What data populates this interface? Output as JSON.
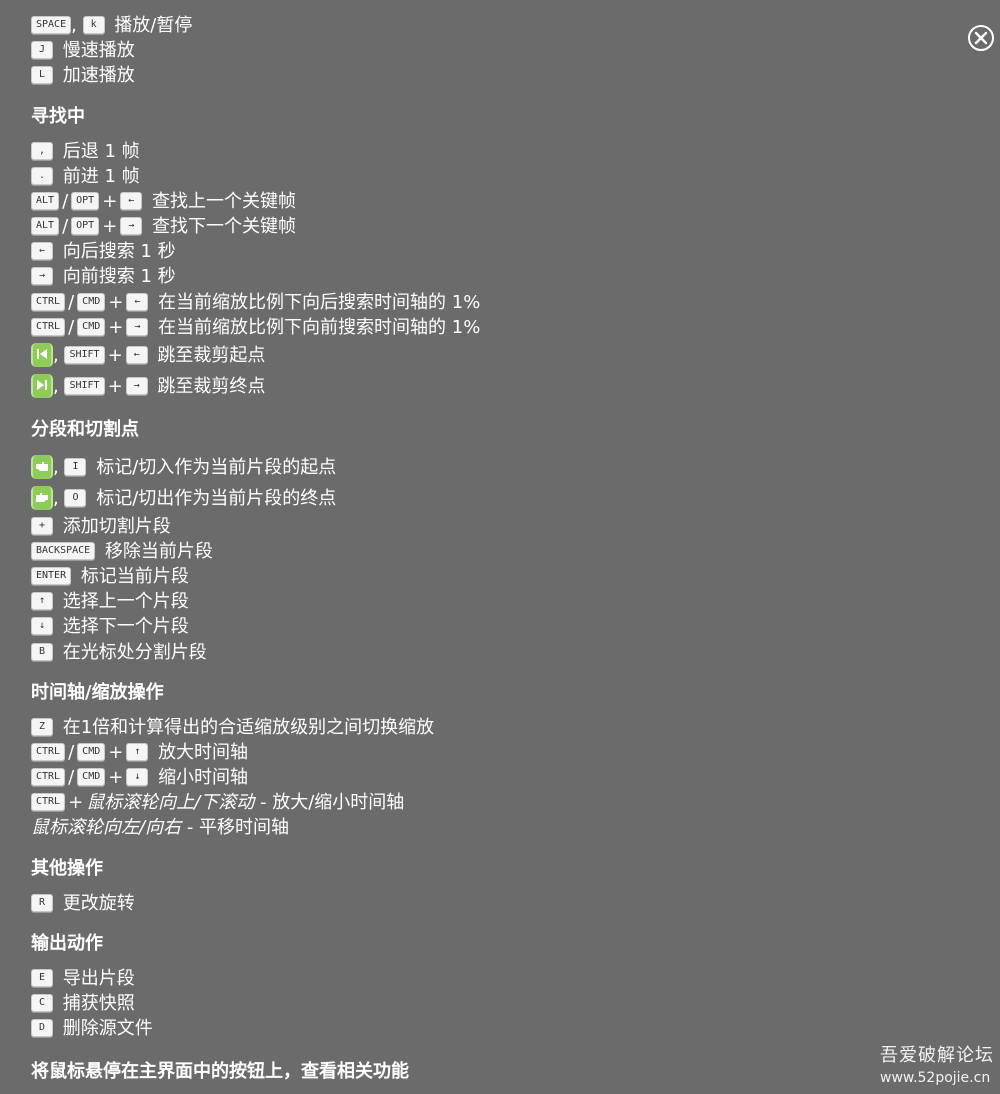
{
  "sections": {
    "playback": {
      "rows": [
        {
          "keys": [
            "SPACE",
            "k"
          ],
          "desc": "播放/暂停"
        },
        {
          "keys": [
            "J"
          ],
          "desc": "慢速播放"
        },
        {
          "keys": [
            "L"
          ],
          "desc": "加速播放"
        }
      ]
    },
    "seeking": {
      "title": "寻找中",
      "rows": [
        {
          "keys": [
            ","
          ],
          "desc": "后退 1 帧"
        },
        {
          "keys": [
            "."
          ],
          "desc": "前进 1 帧"
        },
        {
          "keys": [
            "ALT",
            "OPT",
            "←"
          ],
          "desc": "查找上一个关键帧"
        },
        {
          "keys": [
            "ALT",
            "OPT",
            "→"
          ],
          "desc": "查找下一个关键帧"
        },
        {
          "keys": [
            "←"
          ],
          "desc": "向后搜索 1 秒"
        },
        {
          "keys": [
            "→"
          ],
          "desc": "向前搜索 1 秒"
        },
        {
          "keys": [
            "CTRL",
            "CMD",
            "←"
          ],
          "desc": "在当前缩放比例下向后搜索时间轴的 1%"
        },
        {
          "keys": [
            "CTRL",
            "CMD",
            "→"
          ],
          "desc": "在当前缩放比例下向前搜索时间轴的 1%"
        },
        {
          "keys": [
            "SHIFT",
            "←"
          ],
          "desc": "跳至裁剪起点",
          "icon": "jump-to-start-icon"
        },
        {
          "keys": [
            "SHIFT",
            "→"
          ],
          "desc": "跳至裁剪终点",
          "icon": "jump-to-end-icon"
        }
      ]
    },
    "segments": {
      "title": "分段和切割点",
      "rows": [
        {
          "keys": [
            "I"
          ],
          "desc": "标记/切入作为当前片段的起点",
          "icon": "cut-in-hand-icon"
        },
        {
          "keys": [
            "O"
          ],
          "desc": "标记/切出作为当前片段的终点",
          "icon": "cut-out-hand-icon"
        },
        {
          "keys": [
            "+"
          ],
          "desc": "添加切割片段"
        },
        {
          "keys": [
            "BACKSPACE"
          ],
          "desc": "移除当前片段"
        },
        {
          "keys": [
            "ENTER"
          ],
          "desc": "标记当前片段"
        },
        {
          "keys": [
            "↑"
          ],
          "desc": "选择上一个片段"
        },
        {
          "keys": [
            "↓"
          ],
          "desc": "选择下一个片段"
        },
        {
          "keys": [
            "B"
          ],
          "desc": "在光标处分割片段"
        }
      ]
    },
    "timeline": {
      "title": "时间轴/缩放操作",
      "rows": [
        {
          "keys": [
            "Z"
          ],
          "desc": "在1倍和计算得出的合适缩放级别之间切换缩放"
        },
        {
          "keys": [
            "CTRL",
            "CMD",
            "↑"
          ],
          "desc": "放大时间轴"
        },
        {
          "keys": [
            "CTRL",
            "CMD",
            "↓"
          ],
          "desc": "缩小时间轴"
        },
        {
          "keys": [
            "CTRL"
          ],
          "italic": "鼠标滚轮向上/下滚动",
          "desc": "- 放大/缩小时间轴"
        },
        {
          "keys": [],
          "italic": "鼠标滚轮向左/向右",
          "desc": "- 平移时间轴"
        }
      ]
    },
    "other": {
      "title": "其他操作",
      "rows": [
        {
          "keys": [
            "R"
          ],
          "desc": "更改旋转"
        }
      ]
    },
    "output": {
      "title": "输出动作",
      "rows": [
        {
          "keys": [
            "E"
          ],
          "desc": "导出片段"
        },
        {
          "keys": [
            "C"
          ],
          "desc": "捕获快照"
        },
        {
          "keys": [
            "D"
          ],
          "desc": "删除源文件"
        }
      ]
    }
  },
  "footer_hint": "将鼠标悬停在主界面中的按钮上，查看相关功能",
  "separators": {
    "comma": ",",
    "slash": "/",
    "plus": "+"
  },
  "watermark": {
    "title": "吾爱破解论坛",
    "url": "www.52pojie.cn"
  },
  "colors": {
    "background": "#6b6b6b",
    "text": "#ffffff",
    "key_bg": "#f5f5f5",
    "accent_green": "#8ecb59"
  }
}
